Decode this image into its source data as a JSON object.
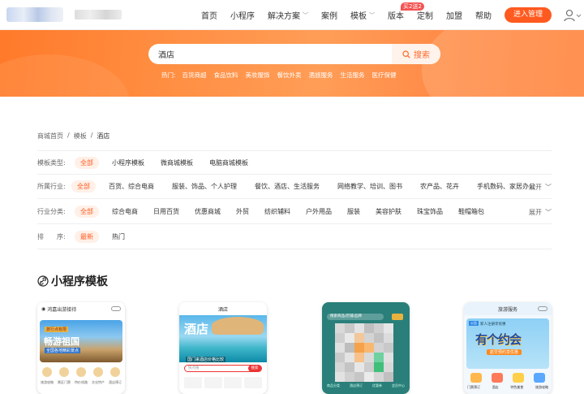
{
  "header": {
    "nav": [
      {
        "label": "首页",
        "has_dropdown": false
      },
      {
        "label": "小程序",
        "has_dropdown": false
      },
      {
        "label": "解决方案",
        "has_dropdown": true
      },
      {
        "label": "案例",
        "has_dropdown": false
      },
      {
        "label": "模板",
        "has_dropdown": true
      },
      {
        "label": "版本",
        "has_dropdown": false
      },
      {
        "label": "定制",
        "has_dropdown": false
      },
      {
        "label": "加盟",
        "has_dropdown": false
      },
      {
        "label": "帮助",
        "has_dropdown": false
      }
    ],
    "badge": "买2送2",
    "enter_label": "进入管理",
    "accent": "#ff5a1f"
  },
  "search": {
    "value": "酒店",
    "button_label": "搜索",
    "hot_label": "热门:",
    "hot_items": [
      "百货商超",
      "食品饮料",
      "美妆服饰",
      "餐饮外卖",
      "酒旅服务",
      "生活服务",
      "医疗保健"
    ]
  },
  "breadcrumb": [
    "商城首页",
    "/",
    "模板",
    "/",
    "酒店"
  ],
  "filters": {
    "type": {
      "label": "模板类型:",
      "options": [
        "全部",
        "小程序模板",
        "微商城模板",
        "电脑商城模板"
      ]
    },
    "industry": {
      "label": "所属行业:",
      "options": [
        "全部",
        "百货、综合电商",
        "服装、饰品、个人护理",
        "餐饮、酒店、生活服务",
        "网络教学、培训、图书",
        "农产品、花卉",
        "手机数码、家居办公"
      ]
    },
    "category": {
      "label": "行业分类:",
      "options": [
        "全部",
        "综合电商",
        "日用百货",
        "优惠商城",
        "外贸",
        "纺织辅料",
        "户外用品",
        "服装",
        "美容护肤",
        "珠宝饰品",
        "鞋帽箱包"
      ]
    },
    "sort": {
      "label": "排　　序:",
      "options": [
        "最新",
        "热门"
      ]
    },
    "expand_label": "展开"
  },
  "section_title": "小程序模板",
  "cards": {
    "c1": {
      "top": "鸿嘉出游接待",
      "tag1": "旅行点有限",
      "title": "畅游祖国",
      "tag2": "全国各地精彩景点",
      "labels": [
        "旅游攻略",
        "景区门票",
        "特价线路",
        "文化特产",
        "酒店预订"
      ]
    },
    "c2": {
      "top": "酒店",
      "script": "酒店",
      "caption": "国门来酒店价格比较",
      "search_placeholder": "快点搜",
      "search_btn": "搜索"
    },
    "c3": {
      "search_placeholder": "搜索商品/店铺/品牌",
      "labels": [
        "商品分类",
        "酒店预订",
        "优惠券",
        "会员中心"
      ]
    },
    "c4": {
      "top": "旅游服务",
      "chip": "公告",
      "line": "新人注册享优惠",
      "slogan": "有个约会",
      "ribbon": "趁早预约享优惠",
      "labels": [
        "门票预订",
        "酒店",
        "特色美食",
        "旅游攻略"
      ]
    }
  }
}
